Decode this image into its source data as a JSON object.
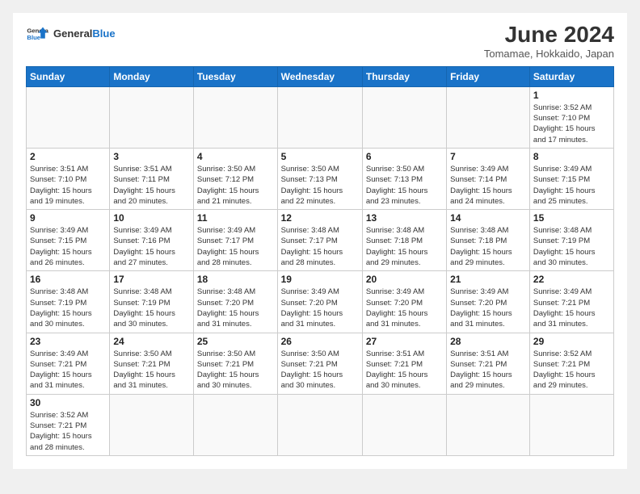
{
  "header": {
    "logo_general": "General",
    "logo_blue": "Blue",
    "month_title": "June 2024",
    "location": "Tomamae, Hokkaido, Japan"
  },
  "columns": [
    "Sunday",
    "Monday",
    "Tuesday",
    "Wednesday",
    "Thursday",
    "Friday",
    "Saturday"
  ],
  "weeks": [
    [
      {
        "day": "",
        "info": ""
      },
      {
        "day": "",
        "info": ""
      },
      {
        "day": "",
        "info": ""
      },
      {
        "day": "",
        "info": ""
      },
      {
        "day": "",
        "info": ""
      },
      {
        "day": "",
        "info": ""
      },
      {
        "day": "1",
        "info": "Sunrise: 3:52 AM\nSunset: 7:10 PM\nDaylight: 15 hours\nand 17 minutes."
      }
    ],
    [
      {
        "day": "2",
        "info": "Sunrise: 3:51 AM\nSunset: 7:10 PM\nDaylight: 15 hours\nand 19 minutes."
      },
      {
        "day": "3",
        "info": "Sunrise: 3:51 AM\nSunset: 7:11 PM\nDaylight: 15 hours\nand 20 minutes."
      },
      {
        "day": "4",
        "info": "Sunrise: 3:50 AM\nSunset: 7:12 PM\nDaylight: 15 hours\nand 21 minutes."
      },
      {
        "day": "5",
        "info": "Sunrise: 3:50 AM\nSunset: 7:13 PM\nDaylight: 15 hours\nand 22 minutes."
      },
      {
        "day": "6",
        "info": "Sunrise: 3:50 AM\nSunset: 7:13 PM\nDaylight: 15 hours\nand 23 minutes."
      },
      {
        "day": "7",
        "info": "Sunrise: 3:49 AM\nSunset: 7:14 PM\nDaylight: 15 hours\nand 24 minutes."
      },
      {
        "day": "8",
        "info": "Sunrise: 3:49 AM\nSunset: 7:15 PM\nDaylight: 15 hours\nand 25 minutes."
      }
    ],
    [
      {
        "day": "9",
        "info": "Sunrise: 3:49 AM\nSunset: 7:15 PM\nDaylight: 15 hours\nand 26 minutes."
      },
      {
        "day": "10",
        "info": "Sunrise: 3:49 AM\nSunset: 7:16 PM\nDaylight: 15 hours\nand 27 minutes."
      },
      {
        "day": "11",
        "info": "Sunrise: 3:49 AM\nSunset: 7:17 PM\nDaylight: 15 hours\nand 28 minutes."
      },
      {
        "day": "12",
        "info": "Sunrise: 3:48 AM\nSunset: 7:17 PM\nDaylight: 15 hours\nand 28 minutes."
      },
      {
        "day": "13",
        "info": "Sunrise: 3:48 AM\nSunset: 7:18 PM\nDaylight: 15 hours\nand 29 minutes."
      },
      {
        "day": "14",
        "info": "Sunrise: 3:48 AM\nSunset: 7:18 PM\nDaylight: 15 hours\nand 29 minutes."
      },
      {
        "day": "15",
        "info": "Sunrise: 3:48 AM\nSunset: 7:19 PM\nDaylight: 15 hours\nand 30 minutes."
      }
    ],
    [
      {
        "day": "16",
        "info": "Sunrise: 3:48 AM\nSunset: 7:19 PM\nDaylight: 15 hours\nand 30 minutes."
      },
      {
        "day": "17",
        "info": "Sunrise: 3:48 AM\nSunset: 7:19 PM\nDaylight: 15 hours\nand 30 minutes."
      },
      {
        "day": "18",
        "info": "Sunrise: 3:48 AM\nSunset: 7:20 PM\nDaylight: 15 hours\nand 31 minutes."
      },
      {
        "day": "19",
        "info": "Sunrise: 3:49 AM\nSunset: 7:20 PM\nDaylight: 15 hours\nand 31 minutes."
      },
      {
        "day": "20",
        "info": "Sunrise: 3:49 AM\nSunset: 7:20 PM\nDaylight: 15 hours\nand 31 minutes."
      },
      {
        "day": "21",
        "info": "Sunrise: 3:49 AM\nSunset: 7:20 PM\nDaylight: 15 hours\nand 31 minutes."
      },
      {
        "day": "22",
        "info": "Sunrise: 3:49 AM\nSunset: 7:21 PM\nDaylight: 15 hours\nand 31 minutes."
      }
    ],
    [
      {
        "day": "23",
        "info": "Sunrise: 3:49 AM\nSunset: 7:21 PM\nDaylight: 15 hours\nand 31 minutes."
      },
      {
        "day": "24",
        "info": "Sunrise: 3:50 AM\nSunset: 7:21 PM\nDaylight: 15 hours\nand 31 minutes."
      },
      {
        "day": "25",
        "info": "Sunrise: 3:50 AM\nSunset: 7:21 PM\nDaylight: 15 hours\nand 30 minutes."
      },
      {
        "day": "26",
        "info": "Sunrise: 3:50 AM\nSunset: 7:21 PM\nDaylight: 15 hours\nand 30 minutes."
      },
      {
        "day": "27",
        "info": "Sunrise: 3:51 AM\nSunset: 7:21 PM\nDaylight: 15 hours\nand 30 minutes."
      },
      {
        "day": "28",
        "info": "Sunrise: 3:51 AM\nSunset: 7:21 PM\nDaylight: 15 hours\nand 29 minutes."
      },
      {
        "day": "29",
        "info": "Sunrise: 3:52 AM\nSunset: 7:21 PM\nDaylight: 15 hours\nand 29 minutes."
      }
    ],
    [
      {
        "day": "30",
        "info": "Sunrise: 3:52 AM\nSunset: 7:21 PM\nDaylight: 15 hours\nand 28 minutes."
      },
      {
        "day": "",
        "info": ""
      },
      {
        "day": "",
        "info": ""
      },
      {
        "day": "",
        "info": ""
      },
      {
        "day": "",
        "info": ""
      },
      {
        "day": "",
        "info": ""
      },
      {
        "day": "",
        "info": ""
      }
    ]
  ]
}
